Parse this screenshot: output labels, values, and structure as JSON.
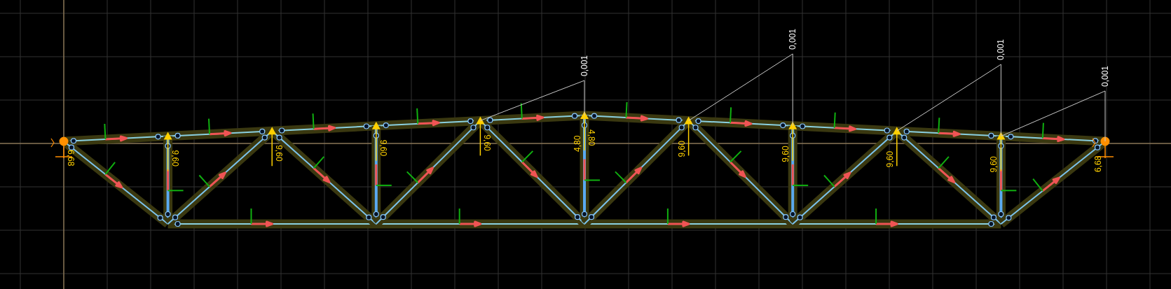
{
  "viewport": {
    "node_labels": [
      [
        "6,68"
      ],
      [
        "9,60"
      ],
      [
        "9,60"
      ],
      [
        "9,60"
      ],
      [
        "9,60"
      ],
      [
        "4,80",
        "4,80"
      ],
      [
        "9,60"
      ],
      [
        "9,60"
      ],
      [
        "9,60"
      ],
      [
        "9,60"
      ],
      [
        "6,68"
      ]
    ],
    "loads": [
      {
        "label": "0,001"
      },
      {
        "label": "0,001"
      },
      {
        "label": "0,001"
      },
      {
        "label": "0,001"
      }
    ]
  }
}
